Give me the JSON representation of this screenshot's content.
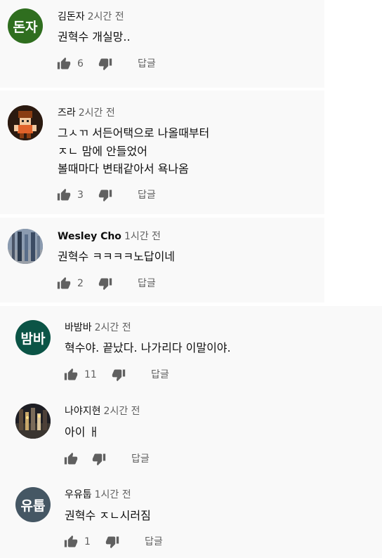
{
  "ui": {
    "reply_label": "답글"
  },
  "comments": [
    {
      "author": "김돈자",
      "time": "2시간 전",
      "avatar_text": "돈자",
      "avatar_color": "#2f6e1f",
      "text": [
        "권혁수 개실망.."
      ],
      "likes": "6"
    },
    {
      "author": "즈라",
      "time": "2시간 전",
      "avatar_text": "",
      "avatar_color": "#3a1d12",
      "text": [
        "그ㅅㄲ 서든어택으로 나올때부터",
        "ㅈㄴ 맘에 안들었어",
        "볼때마다 변태같아서 욕나옴"
      ],
      "likes": "3"
    },
    {
      "author": "Wesley Cho",
      "time": "1시간 전",
      "avatar_text": "",
      "avatar_color": "#6b7a8c",
      "text": [
        "권혁수 ㅋㅋㅋㅋ노답이네"
      ],
      "likes": "2"
    },
    {
      "author": "바밤바",
      "time": "2시간 전",
      "avatar_text": "밤바",
      "avatar_color": "#0b5446",
      "text": [
        "혁수야. 끝났다. 나가리다 이말이야."
      ],
      "likes": "11"
    },
    {
      "author": "나야지현",
      "time": "2시간 전",
      "avatar_text": "",
      "avatar_color": "#2a2a2a",
      "text": [
        "아이 ㅐ"
      ],
      "likes": ""
    },
    {
      "author": "우유툽",
      "time": "1시간 전",
      "avatar_text": "유툽",
      "avatar_color": "#455764",
      "text": [
        "권혁수 ㅈㄴ시러짐"
      ],
      "likes": "1"
    }
  ]
}
